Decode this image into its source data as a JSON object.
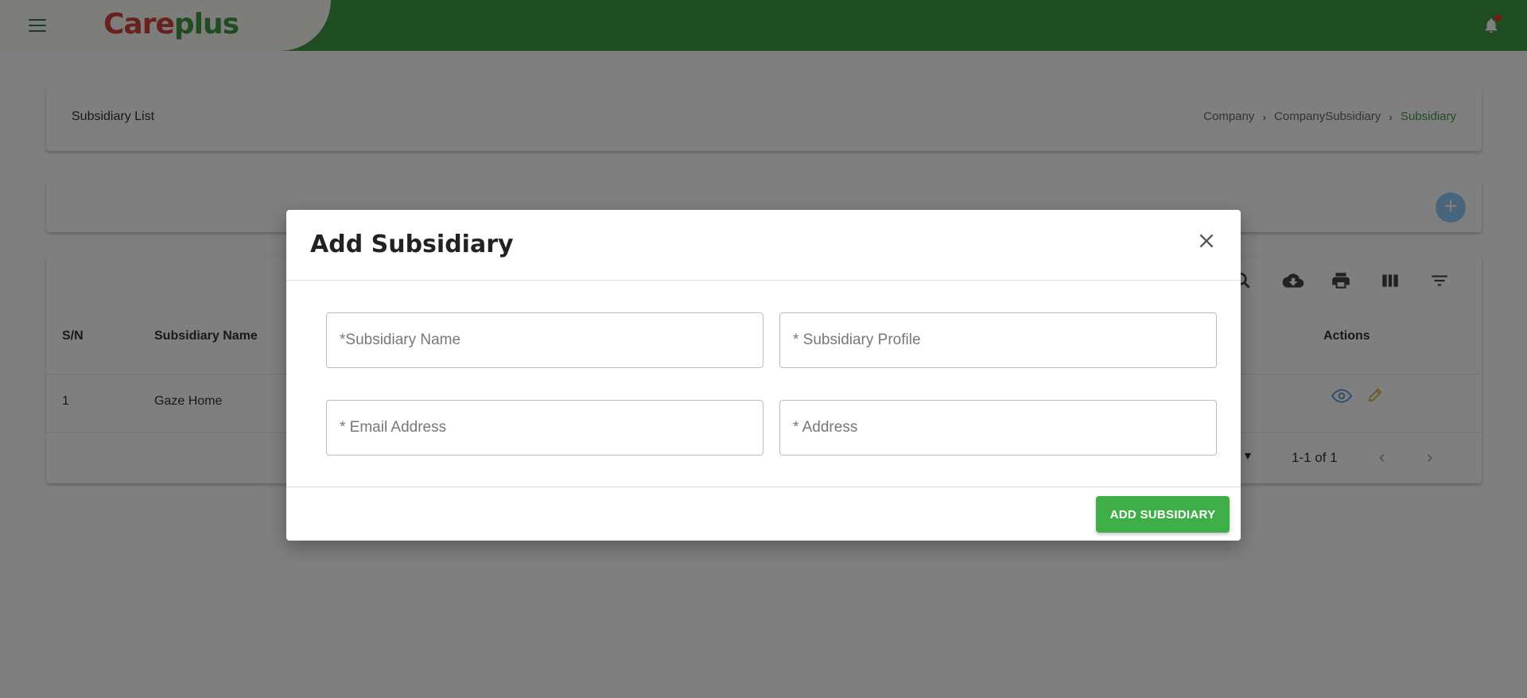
{
  "app": {
    "logo_part1": "Care",
    "logo_part2": "plus"
  },
  "header": {
    "page_title": "Subsidiary List",
    "breadcrumb": [
      "Company",
      "CompanySubsidiary",
      "Subsidiary"
    ]
  },
  "table": {
    "columns": {
      "sn": "S/N",
      "name": "Subsidiary Name",
      "actions": "Actions"
    },
    "rows": [
      {
        "sn": "1",
        "name": "Gaze Home"
      }
    ],
    "pagination": "1-1 of 1"
  },
  "modal": {
    "title": "Add Subsidiary",
    "fields": {
      "name_placeholder": "*Subsidiary Name",
      "profile_placeholder": "* Subsidiary Profile",
      "email_placeholder": "* Email Address",
      "address_placeholder": "* Address"
    },
    "submit_label": "ADD SUBSIDIARY"
  },
  "icons": {
    "menu": "hamburger-menu-icon",
    "notification": "bell-icon",
    "add": "plus-icon",
    "search": "search-icon",
    "download": "cloud-download-icon",
    "print": "print-icon",
    "columns": "view-column-icon",
    "filter": "filter-icon",
    "view": "eye-icon",
    "edit": "pencil-icon",
    "close": "close-icon"
  },
  "colors": {
    "brand_green": "#3e9a42",
    "brand_red": "#d0443d",
    "button_green": "#3fae49",
    "fab_blue": "#90caf9"
  }
}
